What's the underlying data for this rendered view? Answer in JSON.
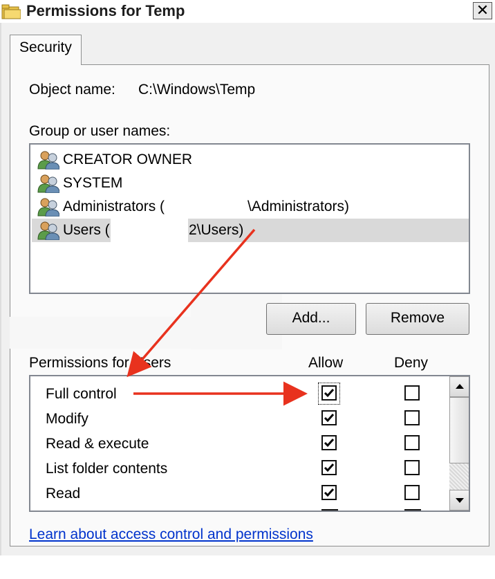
{
  "window": {
    "title": "Permissions for Temp",
    "close_glyph": "✕"
  },
  "tabs": [
    {
      "label": "Security",
      "active": true
    }
  ],
  "object": {
    "label": "Object name:",
    "value": "C:\\Windows\\Temp"
  },
  "users": {
    "heading": "Group or user names:",
    "items": [
      {
        "label": "CREATOR OWNER",
        "icon": "users-group-icon",
        "selected": false
      },
      {
        "label": "SYSTEM",
        "icon": "users-group-icon",
        "selected": false
      },
      {
        "label_start": "Administrators (",
        "label_end": "\\Administrators)",
        "icon": "users-group-icon",
        "selected": false
      },
      {
        "label_start": "Users (",
        "label_end": "2\\Users)",
        "icon": "users-group-icon",
        "selected": true
      }
    ]
  },
  "buttons": {
    "add": "Add...",
    "remove": "Remove"
  },
  "permissions": {
    "heading": "Permissions for Users",
    "allow_header": "Allow",
    "deny_header": "Deny",
    "items": [
      {
        "name": "Full control",
        "allow": true,
        "deny": false
      },
      {
        "name": "Modify",
        "allow": true,
        "deny": false
      },
      {
        "name": "Read & execute",
        "allow": true,
        "deny": false
      },
      {
        "name": "List folder contents",
        "allow": true,
        "deny": false
      },
      {
        "name": "Read",
        "allow": true,
        "deny": false
      }
    ]
  },
  "link": {
    "text": "Learn about access control and permissions"
  },
  "colors": {
    "annotation_arrow": "#e8321e",
    "link": "#0033cc",
    "selection": "#d9d9d9"
  }
}
